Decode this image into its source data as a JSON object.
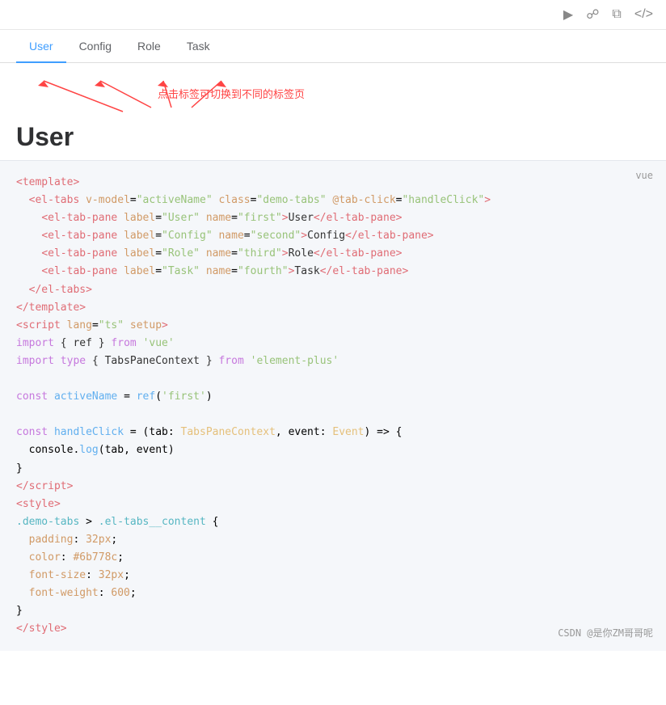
{
  "toolbar": {
    "icons": [
      "play-icon",
      "bookmark-icon",
      "copy-icon",
      "code-icon"
    ]
  },
  "tabs": {
    "items": [
      {
        "label": "User",
        "active": true
      },
      {
        "label": "Config",
        "active": false
      },
      {
        "label": "Role",
        "active": false
      },
      {
        "label": "Task",
        "active": false
      }
    ]
  },
  "annotation": {
    "text": "点击标签可切换到不同的标签页"
  },
  "preview": {
    "active_tab_content": "User"
  },
  "vue_label": "vue",
  "code": {
    "lines": []
  },
  "watermark": "CSDN @是你ZM哥哥呢"
}
